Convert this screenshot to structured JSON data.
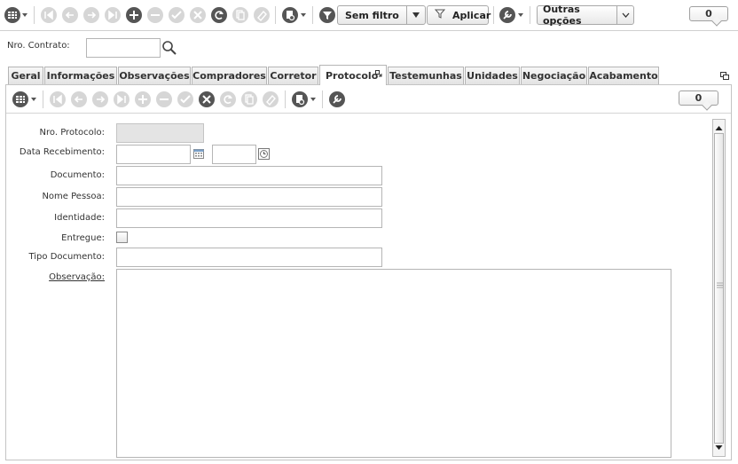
{
  "toolbar": {
    "filter_label": "Sem filtro",
    "apply_label": "Aplicar",
    "more_options_label": "Outras opções",
    "record_count": "0"
  },
  "search": {
    "contract_label": "Nro. Contrato:",
    "contract_value": ""
  },
  "tabs": [
    {
      "label": "Geral"
    },
    {
      "label": "Informações"
    },
    {
      "label": "Observações"
    },
    {
      "label": "Compradores"
    },
    {
      "label": "Corretor"
    },
    {
      "label": "Protocolo"
    },
    {
      "label": "Testemunhas"
    },
    {
      "label": "Unidades"
    },
    {
      "label": "Negociação"
    },
    {
      "label": "Acabamento"
    }
  ],
  "active_tab": "Protocolo",
  "panel": {
    "record_count": "0",
    "fields": {
      "protocol_label": "Nro. Protocolo:",
      "date_label": "Data Recebimento:",
      "document_label": "Documento:",
      "person_label": "Nome Pessoa:",
      "identity_label": "Identidade:",
      "delivered_label": "Entregue:",
      "doc_type_label": "Tipo Documento:",
      "notes_label": "Observação:"
    }
  },
  "icons": {
    "grid_menu": "grid-menu-icon",
    "first": "first-record-icon",
    "prev": "previous-record-icon",
    "next": "next-record-icon",
    "last": "last-record-icon",
    "add": "add-icon",
    "remove": "remove-icon",
    "confirm": "confirm-icon",
    "cancel": "cancel-icon",
    "refresh": "refresh-icon",
    "copy": "copy-icon",
    "clear": "eraser-icon",
    "report": "report-icon",
    "filter": "filter-icon",
    "settings": "wrench-icon",
    "search": "search-icon",
    "calendar": "calendar-icon",
    "clock": "clock-icon",
    "detach": "detach-icon"
  },
  "colors": {
    "disabled_icon": "#d6d6d6",
    "dark_icon": "#555555",
    "border": "#b5b5b5",
    "readonly_field": "#e4e4e4"
  }
}
